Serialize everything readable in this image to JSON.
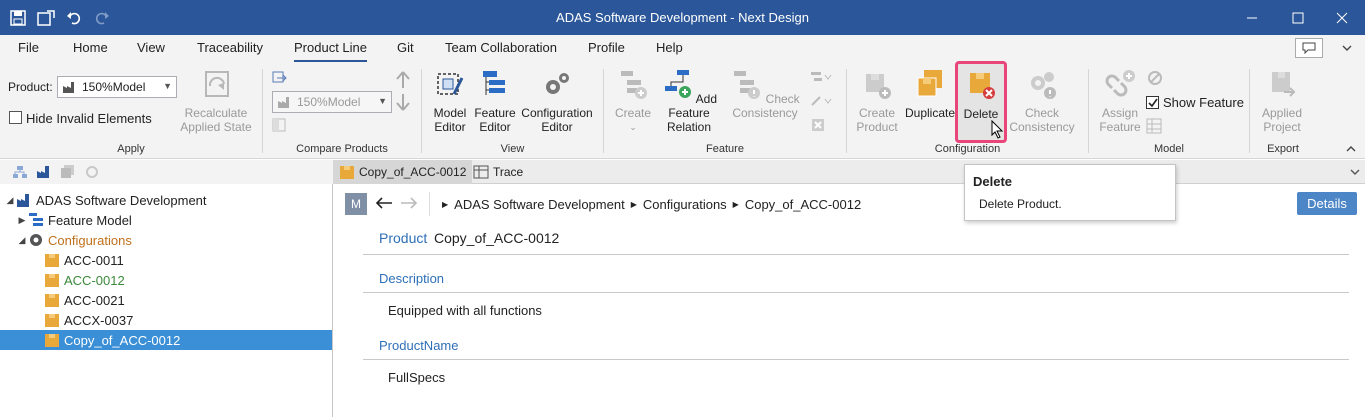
{
  "window": {
    "title": "ADAS Software Development - Next Design"
  },
  "menu": [
    "File",
    "Home",
    "View",
    "Traceability",
    "Product Line",
    "Git",
    "Team Collaboration",
    "Profile",
    "Help"
  ],
  "ribbon": {
    "apply": {
      "product_label": "Product:",
      "product_value": "150%Model",
      "hide_invalid": "Hide Invalid Elements",
      "recalc": "Recalculate Applied State",
      "group": "Apply"
    },
    "compare": {
      "combo_value": "150%Model",
      "group": "Compare Products"
    },
    "view": {
      "model_editor": "Model Editor",
      "feature_editor": "Feature Editor",
      "configuration_editor": "Configuration Editor",
      "group": "View"
    },
    "feature": {
      "create": "Create",
      "add_relation": "Add Feature Relation",
      "check_consistency": "Check Consistency",
      "group": "Feature"
    },
    "configuration": {
      "create_product": "Create Product",
      "duplicate": "Duplicate",
      "delete": "Delete",
      "check_consistency": "Check Consistency",
      "group": "Configuration"
    },
    "model": {
      "assign_feature": "Assign Feature",
      "show_feature": "Show Feature",
      "group": "Model"
    },
    "export": {
      "applied_project": "Applied Project",
      "group": "Export"
    }
  },
  "tree": {
    "root": "ADAS Software Development",
    "feature_model": "Feature Model",
    "configurations": "Configurations",
    "items": [
      "ACC-0011",
      "ACC-0012",
      "ACC-0021",
      "ACCX-0037",
      "Copy_of_ACC-0012"
    ]
  },
  "tabs": [
    "Copy_of_ACC-0012",
    "Trace"
  ],
  "breadcrumb": {
    "m_badge": "M",
    "items": [
      "ADAS Software Development",
      "Configurations",
      "Copy_of_ACC-0012"
    ]
  },
  "details_label": "Details",
  "product": {
    "kind": "Product",
    "name": "Copy_of_ACC-0012",
    "description_label": "Description",
    "description_value": "Equipped with all functions",
    "productname_label": "ProductName",
    "productname_value": "FullSpecs"
  },
  "tooltip": {
    "title": "Delete",
    "body": "Delete Product."
  },
  "colors": {
    "titlebar": "#2b579a",
    "accent_blue": "#2e6fb7",
    "selection": "#3b8fd6",
    "highlight": "#e8457b",
    "box_orange": "#e8a83a",
    "green_text": "#3a8a3a",
    "orange_text": "#c0701c"
  }
}
